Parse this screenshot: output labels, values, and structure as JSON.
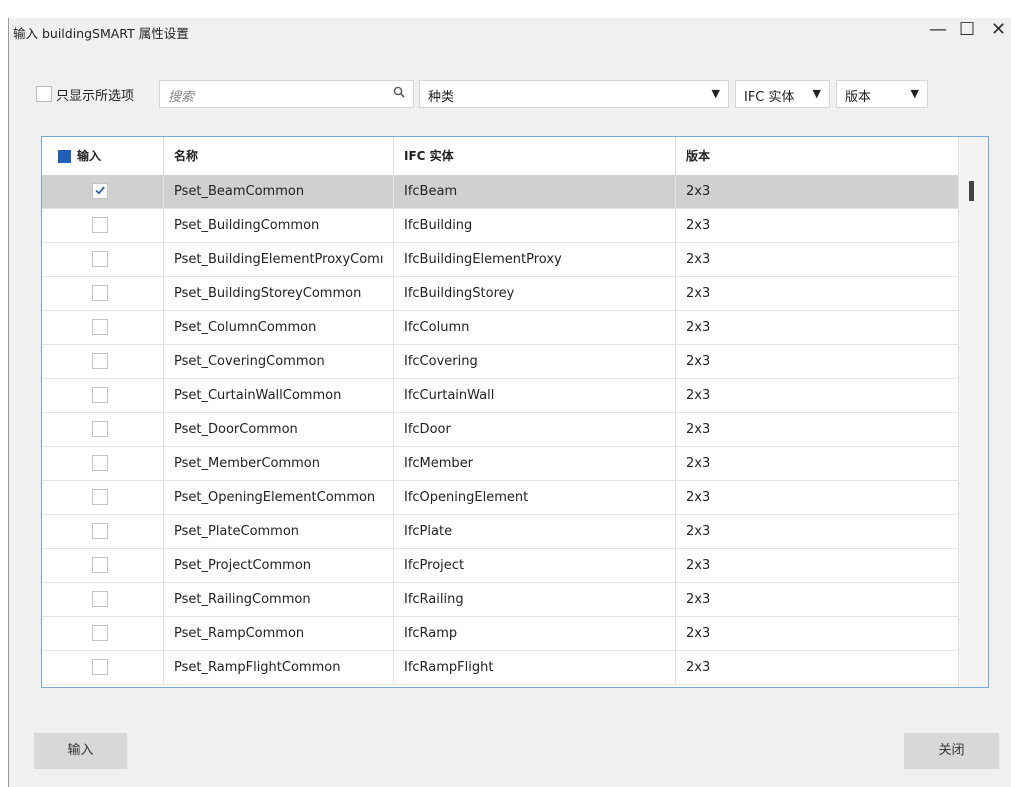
{
  "window": {
    "title": "输入 buildingSMART 属性设置",
    "minimize_glyph": "—",
    "maximize_glyph": "☐",
    "close_glyph": "✕"
  },
  "toolbar": {
    "show_selected_label": "只显示所选项",
    "search_placeholder": "搜索",
    "category_label": "种类",
    "ifc_entity_label": "IFC 实体",
    "version_label": "版本",
    "dropdown_arrow": "▼",
    "search_icon": "search-icon"
  },
  "table": {
    "columns": {
      "import": "输入",
      "name": "名称",
      "ifc_entity": "IFC 实体",
      "version": "版本"
    },
    "rows": [
      {
        "checked": true,
        "name": "Pset_BeamCommon",
        "entity": "IfcBeam",
        "version": "2x3"
      },
      {
        "checked": false,
        "name": "Pset_BuildingCommon",
        "entity": "IfcBuilding",
        "version": "2x3"
      },
      {
        "checked": false,
        "name": "Pset_BuildingElementProxyComı",
        "entity": "IfcBuildingElementProxy",
        "version": "2x3"
      },
      {
        "checked": false,
        "name": "Pset_BuildingStoreyCommon",
        "entity": "IfcBuildingStorey",
        "version": "2x3"
      },
      {
        "checked": false,
        "name": "Pset_ColumnCommon",
        "entity": "IfcColumn",
        "version": "2x3"
      },
      {
        "checked": false,
        "name": "Pset_CoveringCommon",
        "entity": "IfcCovering",
        "version": "2x3"
      },
      {
        "checked": false,
        "name": "Pset_CurtainWallCommon",
        "entity": "IfcCurtainWall",
        "version": "2x3"
      },
      {
        "checked": false,
        "name": "Pset_DoorCommon",
        "entity": "IfcDoor",
        "version": "2x3"
      },
      {
        "checked": false,
        "name": "Pset_MemberCommon",
        "entity": "IfcMember",
        "version": "2x3"
      },
      {
        "checked": false,
        "name": "Pset_OpeningElementCommon",
        "entity": "IfcOpeningElement",
        "version": "2x3"
      },
      {
        "checked": false,
        "name": "Pset_PlateCommon",
        "entity": "IfcPlate",
        "version": "2x3"
      },
      {
        "checked": false,
        "name": "Pset_ProjectCommon",
        "entity": "IfcProject",
        "version": "2x3"
      },
      {
        "checked": false,
        "name": "Pset_RailingCommon",
        "entity": "IfcRailing",
        "version": "2x3"
      },
      {
        "checked": false,
        "name": "Pset_RampCommon",
        "entity": "IfcRamp",
        "version": "2x3"
      },
      {
        "checked": false,
        "name": "Pset_RampFlightCommon",
        "entity": "IfcRampFlight",
        "version": "2x3"
      }
    ]
  },
  "footer": {
    "import_button": "输入",
    "close_button": "关闭"
  },
  "colors": {
    "accent": "#1f5fb8",
    "selected_row": "#d0d0d0",
    "table_border": "#7aa7d8",
    "window_bg": "#f0f0f0"
  }
}
